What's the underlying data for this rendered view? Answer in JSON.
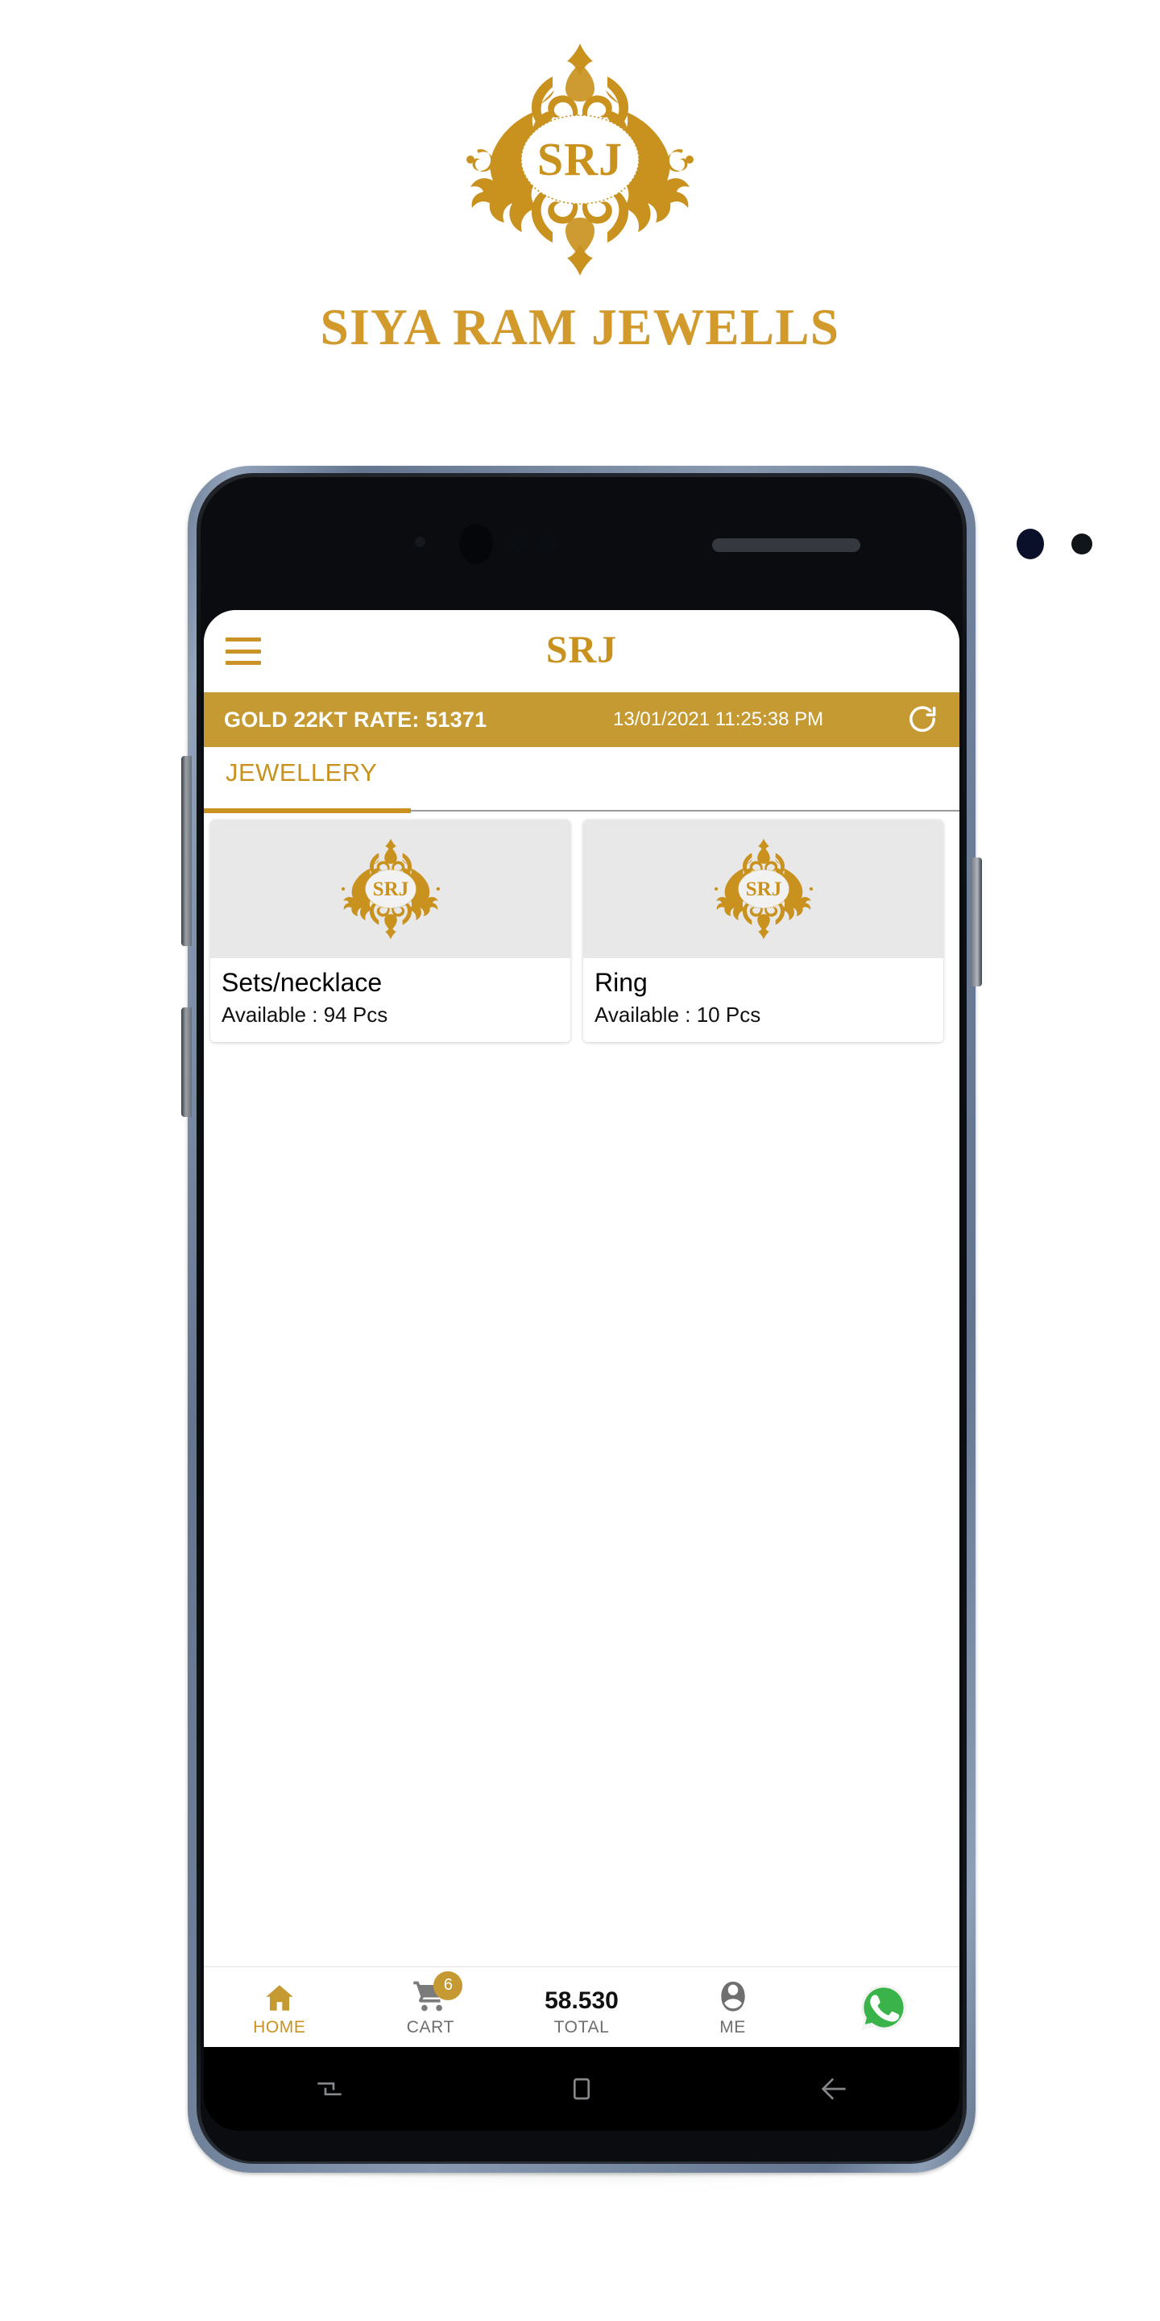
{
  "brand": {
    "logo_icon": "srj-ornate-monogram-logo",
    "title": "SIYA RAM JEWELLS",
    "gold_color": "#d19a2a"
  },
  "app": {
    "app_bar": {
      "menu_icon": "hamburger-menu-icon",
      "title": "SRJ"
    },
    "rate_bar": {
      "rate_label": "GOLD 22KT RATE: 51371",
      "timestamp": "13/01/2021 11:25:38 PM",
      "refresh_icon": "refresh-icon",
      "background_color": "#c69a32"
    },
    "tabs": [
      {
        "label": "JEWELLERY",
        "active": true
      }
    ],
    "products": [
      {
        "name": "Sets/necklace",
        "availability": "Available : 94 Pcs",
        "image_icon": "srj-ornate-monogram-logo"
      },
      {
        "name": "Ring",
        "availability": "Available : 10 Pcs",
        "image_icon": "srj-ornate-monogram-logo"
      }
    ],
    "bottom_nav": [
      {
        "label": "HOME",
        "icon": "home-icon",
        "active": true,
        "badge": null
      },
      {
        "label": "CART",
        "icon": "cart-icon",
        "active": false,
        "badge": "6"
      },
      {
        "label": "TOTAL",
        "icon": "total-value",
        "active": false,
        "value": "58.530"
      },
      {
        "label": "ME",
        "icon": "person-icon",
        "active": false,
        "badge": null
      },
      {
        "label": "",
        "icon": "whatsapp-icon",
        "active": false,
        "badge": null
      }
    ],
    "android_nav": [
      {
        "icon": "recents-icon"
      },
      {
        "icon": "home-square-icon"
      },
      {
        "icon": "back-arrow-icon"
      }
    ]
  }
}
